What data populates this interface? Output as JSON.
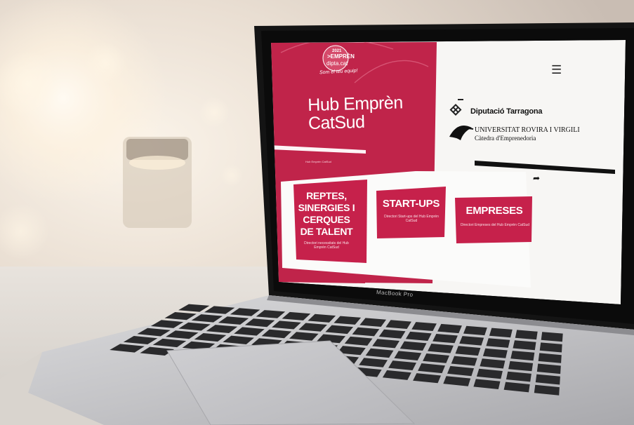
{
  "site": {
    "badge_year": "2021",
    "badge_brand": ">EMPRÈN",
    "badge_domain": "dipta.cat",
    "slogan": "Som el teu equip!",
    "hub_title": "Hub Emprèn CatSud",
    "hub_caption": "Hub Emprèn CatSud",
    "menu_icon": "hamburger-icon",
    "share_icon": "share-arrow-icon"
  },
  "partners": {
    "dipu_name": "Diputació Tarragona",
    "urv_name": "UNIVERSITAT ROVIRA I VIRGILI",
    "urv_chair": "Càtedra d'Emprenedoria"
  },
  "cards": [
    {
      "title": "REPTES, SINERGIES I CERQUES DE TALENT",
      "description": "Directori necessitats del Hub Emprèn CatSud"
    },
    {
      "title": "START-UPS",
      "description": "Directori Start-ups del Hub Emprèn CatSud"
    },
    {
      "title": "EMPRESES",
      "description": "Directori Empreses del Hub Emprèn CatSud"
    }
  ],
  "device": {
    "bezel_label": "MacBook Pro"
  },
  "colors": {
    "accent": "#c0244a",
    "card": "#c6214b",
    "page_white": "#f7f6f4",
    "laptop_body": "#c9c9cb",
    "key": "#2a2a2c"
  }
}
